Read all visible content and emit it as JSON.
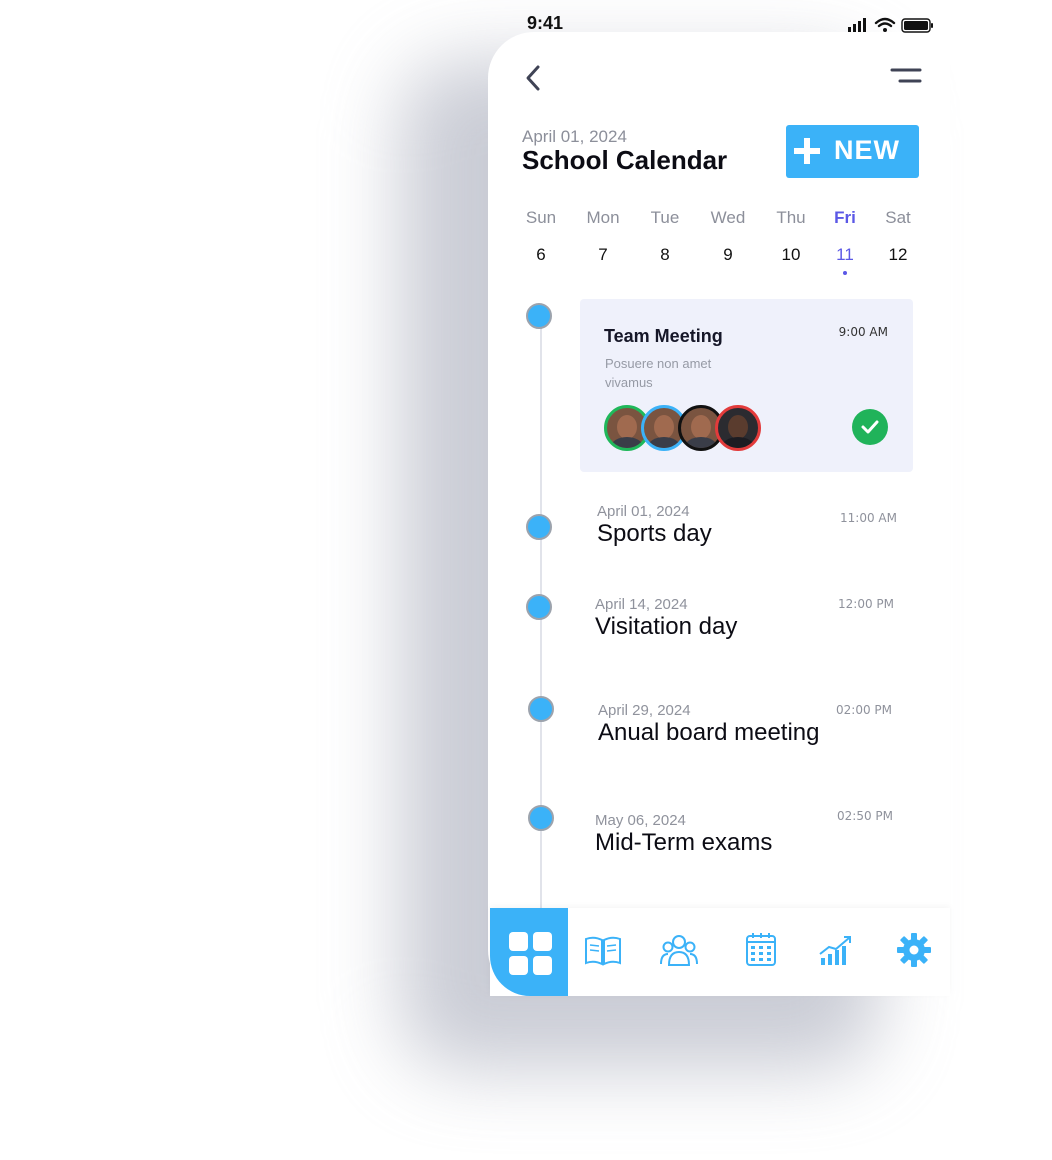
{
  "status_bar": {
    "time": "9:41"
  },
  "header": {
    "date": "April 01, 2024",
    "title": "School Calendar",
    "new_button_label": "NEW"
  },
  "week": [
    {
      "name": "Sun",
      "date": "6",
      "active": false
    },
    {
      "name": "Mon",
      "date": "7",
      "active": false
    },
    {
      "name": "Tue",
      "date": "8",
      "active": false
    },
    {
      "name": "Wed",
      "date": "9",
      "active": false
    },
    {
      "name": "Thu",
      "date": "10",
      "active": false
    },
    {
      "name": "Fri",
      "date": "11",
      "active": true
    },
    {
      "name": "Sat",
      "date": "12",
      "active": false
    }
  ],
  "featured_event": {
    "title": "Team Meeting",
    "time": "9:00 AM",
    "description": "Posuere non amet vivamus",
    "attendee_ring_colors": [
      "#1fb85a",
      "#3bb2f8",
      "#111111",
      "#e23b3b"
    ],
    "status": "done"
  },
  "events": [
    {
      "date": "April 01, 2024",
      "title": "Sports day",
      "time": "11:00 AM"
    },
    {
      "date": "April 14, 2024",
      "title": "Visitation day",
      "time": "12:00 PM"
    },
    {
      "date": "April 29, 2024",
      "title": "Anual board meeting",
      "time": "02:00 PM"
    },
    {
      "date": "May 06, 2024",
      "title": "Mid-Term exams",
      "time": "02:50 PM"
    }
  ],
  "tab_bar": {
    "items": [
      "dashboard-icon",
      "book-icon",
      "users-icon",
      "calendar-icon",
      "chart-icon",
      "settings-icon"
    ],
    "active": "dashboard-icon"
  },
  "colors": {
    "accent": "#3bb2f8",
    "active_day": "#5b58e6",
    "success": "#20b35a"
  }
}
